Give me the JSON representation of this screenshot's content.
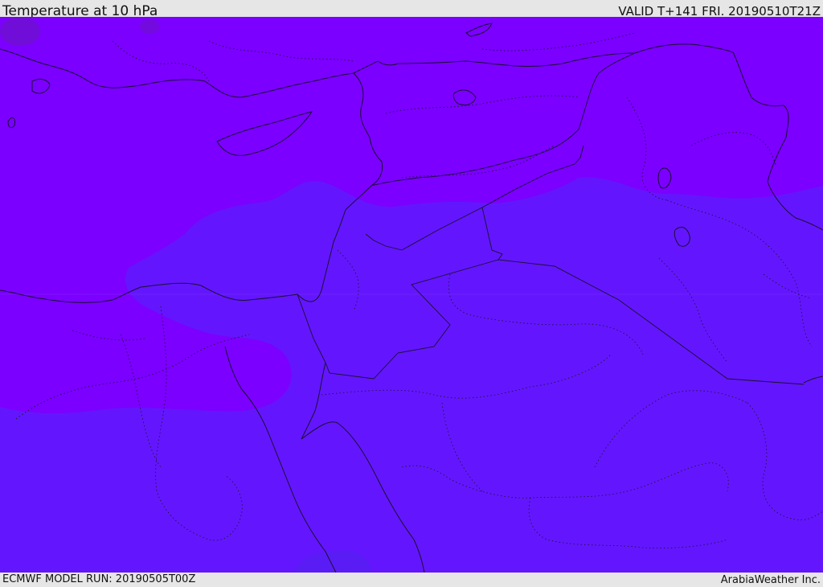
{
  "header": {
    "title": "Temperature at 10 hPa",
    "valid_time": "VALID T+141 FRI. 20190510T21Z"
  },
  "footer": {
    "model_run": "ECMWF MODEL RUN: 20190505T00Z",
    "credit": "ArabiaWeather Inc."
  },
  "map": {
    "field_colors": {
      "outer": "#7b00ff",
      "inner": "#6316fd",
      "warm_spot": "#6a18b8"
    },
    "border_color": "#1a1030"
  }
}
